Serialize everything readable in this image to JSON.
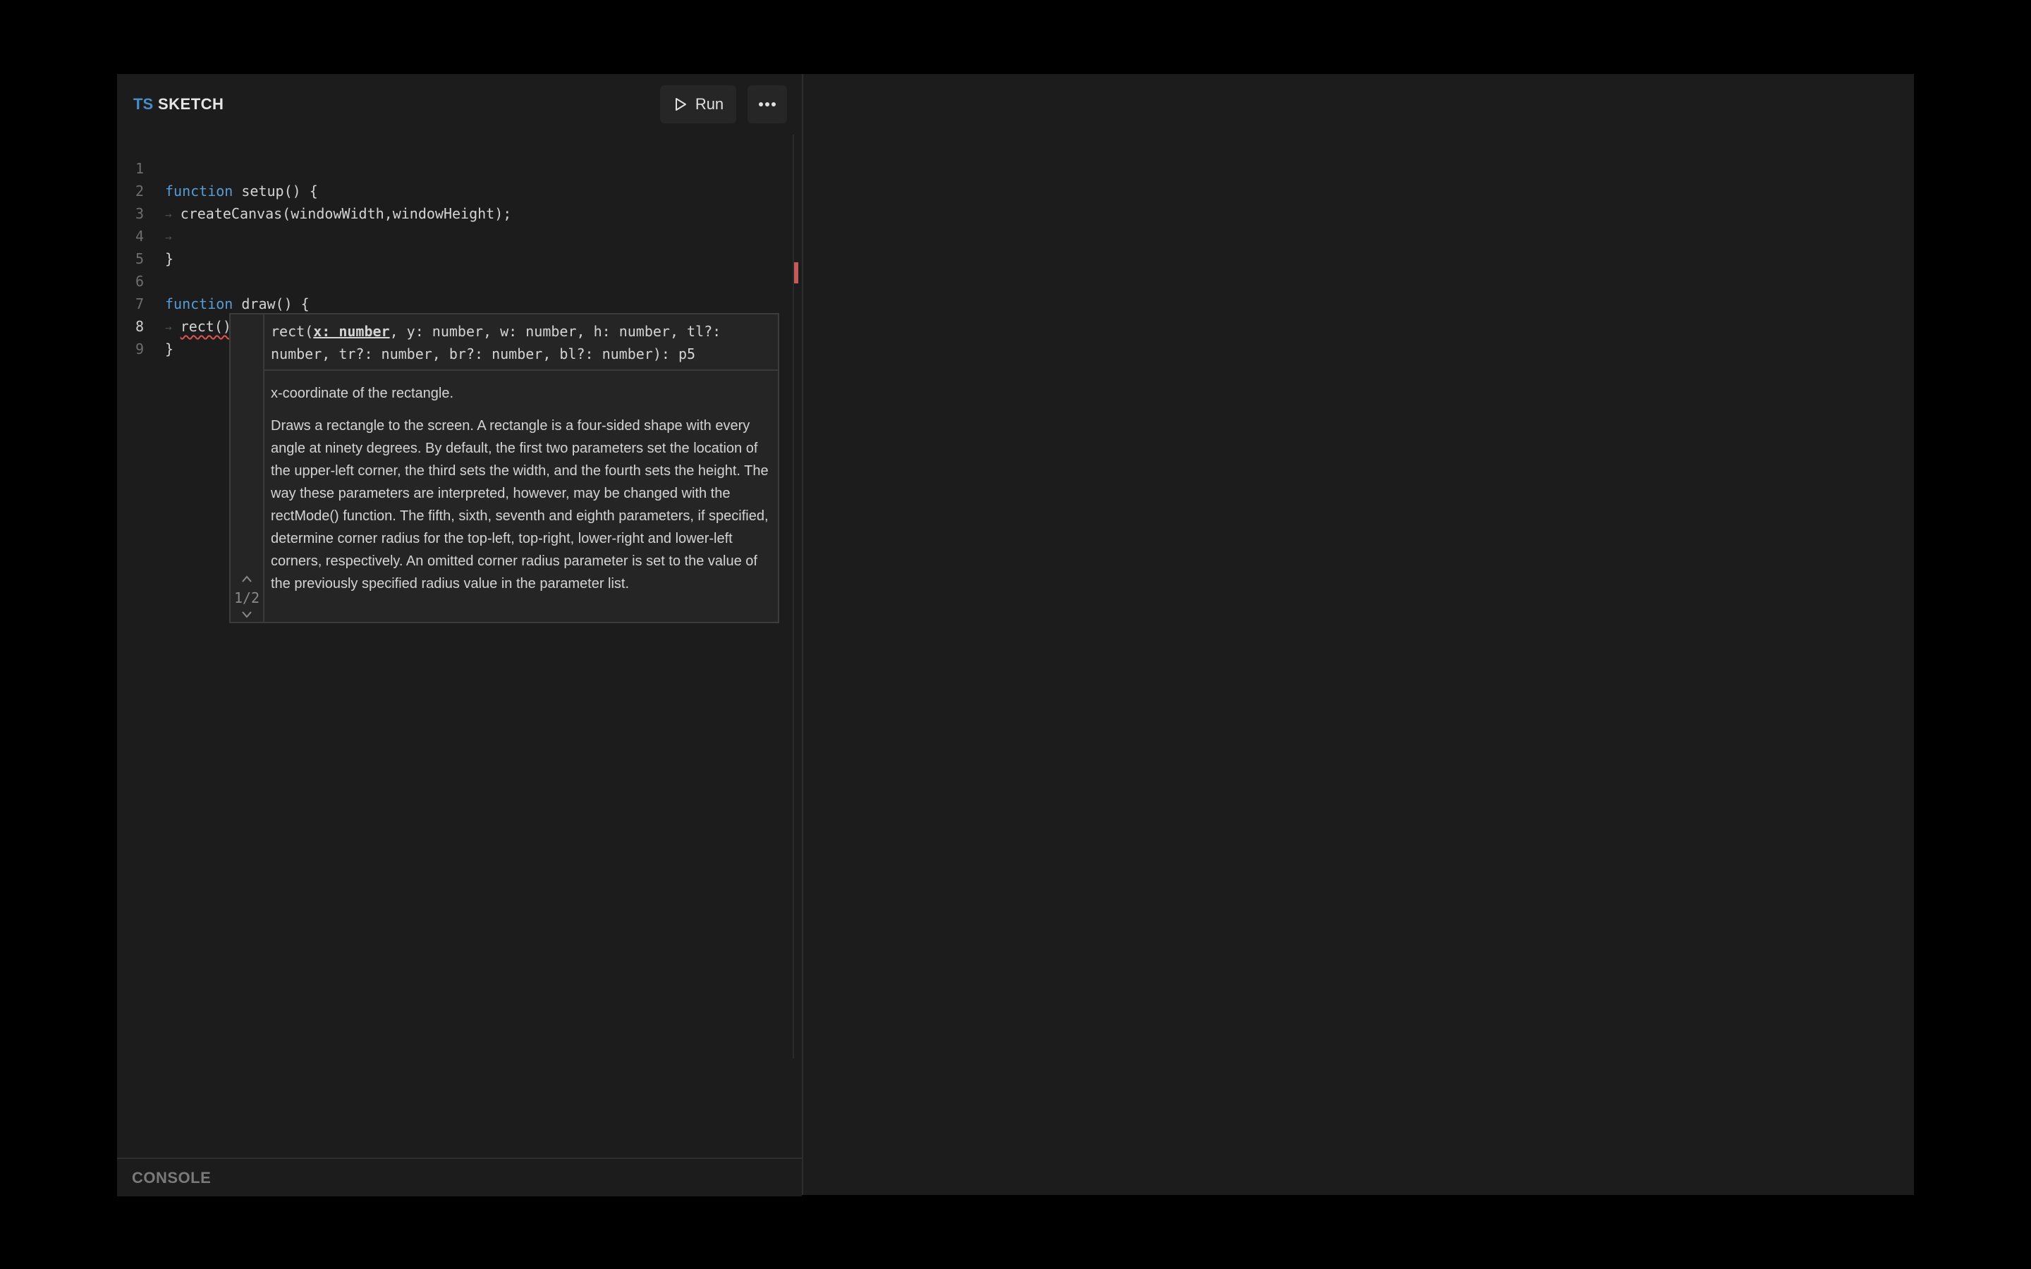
{
  "app": {
    "file_type_badge": "TS",
    "file_title": "SKETCH",
    "run_label": "Run",
    "console_label": "CONSOLE"
  },
  "editor": {
    "active_line": 8,
    "lines": [
      {
        "num": "1",
        "text": ""
      },
      {
        "num": "2",
        "keyword": "function",
        "rest": " setup() {"
      },
      {
        "num": "3",
        "indent": true,
        "text": "createCanvas(windowWidth,windowHeight);"
      },
      {
        "num": "4",
        "indent": true,
        "text": ""
      },
      {
        "num": "5",
        "text": "}"
      },
      {
        "num": "6",
        "text": ""
      },
      {
        "num": "7",
        "keyword": "function",
        "rest": " draw() {"
      },
      {
        "num": "8",
        "indent": true,
        "text": "rect()"
      },
      {
        "num": "9",
        "text": "}"
      }
    ]
  },
  "signature_help": {
    "signature_prefix": "rect(",
    "active_param": "x: number",
    "signature_suffix": ", y: number, w: number, h: number, tl?: number, tr?: number, br?: number, bl?: number): p5",
    "param_doc": "x-coordinate of the rectangle.",
    "doc": "Draws a rectangle to the screen. A rectangle is a four-sided shape with every angle at ninety degrees. By default, the first two parameters set the location of the upper-left corner, the third sets the width, and the fourth sets the height. The way these parameters are interpreted, however, may be changed with the rectMode() function. The fifth, sixth, seventh and eighth parameters, if specified, determine corner radius for the top-left, top-right, lower-right and lower-left corners, respectively. An omitted corner radius parameter is set to the value of the previously specified radius value in the parameter list.",
    "counter": "1/2"
  },
  "icons": {
    "run": "play-icon",
    "more": "ellipsis-icon",
    "prev": "chevron-up-icon",
    "next": "chevron-down-icon"
  },
  "colors": {
    "keyword": "#569cd6",
    "ts_badge": "#4a8cc9",
    "error_squiggle": "#e05252"
  }
}
